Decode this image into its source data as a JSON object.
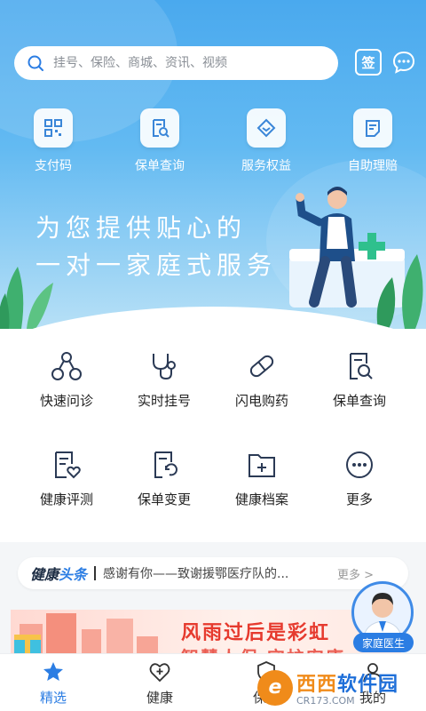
{
  "search": {
    "placeholder": "挂号、保险、商城、资讯、视频"
  },
  "header": {
    "sign_label": "签"
  },
  "quick_actions": [
    {
      "label": "支付码",
      "icon": "qr-code-icon"
    },
    {
      "label": "保单查询",
      "icon": "policy-search-icon"
    },
    {
      "label": "服务权益",
      "icon": "diamond-icon"
    },
    {
      "label": "自助理赔",
      "icon": "claim-doc-icon"
    }
  ],
  "hero": {
    "slogan_line1": "为您提供贴心的",
    "slogan_line2": "一对一家庭式服务"
  },
  "services": [
    {
      "label": "快速问诊",
      "icon": "consult-icon"
    },
    {
      "label": "实时挂号",
      "icon": "stethoscope-icon"
    },
    {
      "label": "闪电购药",
      "icon": "pill-icon"
    },
    {
      "label": "保单查询",
      "icon": "policy-search-icon"
    },
    {
      "label": "健康评测",
      "icon": "health-check-icon"
    },
    {
      "label": "保单变更",
      "icon": "policy-change-icon"
    },
    {
      "label": "健康档案",
      "icon": "health-folder-icon"
    },
    {
      "label": "更多",
      "icon": "more-icon"
    }
  ],
  "news": {
    "brand_a": "健康",
    "brand_b": "头条",
    "headline": "感谢有你——致谢援鄂医疗队的...",
    "more": "更多 >"
  },
  "banner": {
    "title": "风雨过后是彩虹",
    "subtitle": "智慧人保 守护安康"
  },
  "doctor": {
    "label": "家庭医生"
  },
  "tabs": [
    {
      "label": "精选",
      "icon": "star-icon",
      "active": true
    },
    {
      "label": "健康",
      "icon": "heart-plus-icon",
      "active": false
    },
    {
      "label": "保险",
      "icon": "shield-icon",
      "active": false
    },
    {
      "label": "我的",
      "icon": "user-icon",
      "active": false
    }
  ],
  "watermark": {
    "brand_a": "西西",
    "brand_b": "软件园",
    "url": "CR173.COM"
  },
  "colors": {
    "primary": "#2b7de3",
    "hero_top": "#4aa9ee",
    "banner_red": "#e63a2e",
    "text": "#222222"
  }
}
